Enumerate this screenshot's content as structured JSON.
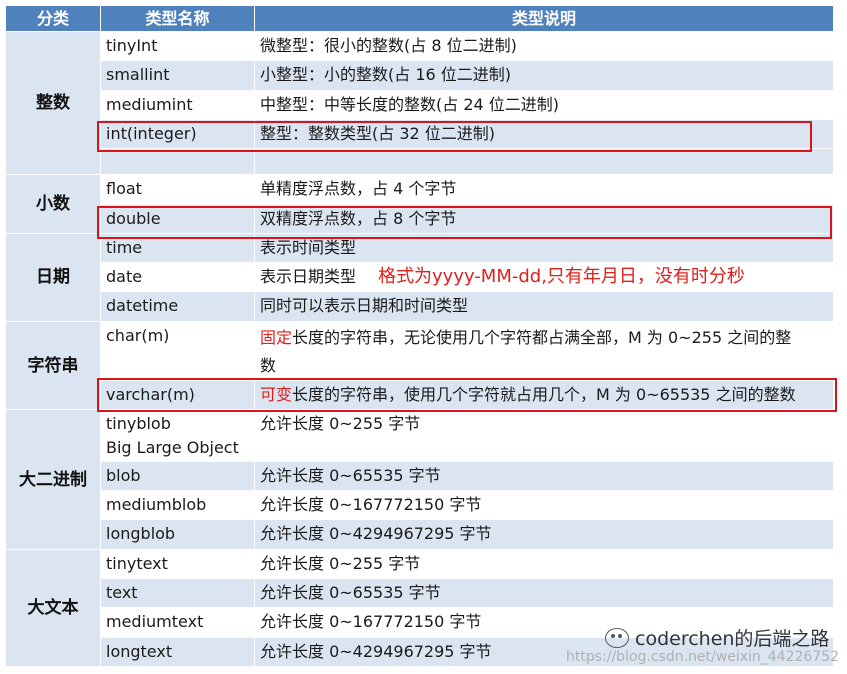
{
  "header": {
    "col_category": "分类",
    "col_type_name": "类型名称",
    "col_description": "类型说明"
  },
  "groups": [
    {
      "category": "整数",
      "rows": [
        {
          "type": "tinyInt",
          "desc": "微整型：很小的整数(占 8 位二进制)"
        },
        {
          "type": "smallint",
          "desc": "小整型：小的整数(占 16 位二进制)"
        },
        {
          "type": "mediumint",
          "desc": "中整型：中等长度的整数(占 24 位二进制)"
        },
        {
          "type": "int(integer)",
          "desc": "整型：整数类型(占 32 位二进制)"
        }
      ]
    },
    {
      "category": "小数",
      "rows": [
        {
          "type": "float",
          "desc": "单精度浮点数，占 4 个字节"
        },
        {
          "type": "double",
          "desc": "双精度浮点数，占 8 个字节"
        }
      ]
    },
    {
      "category": "日期",
      "rows": [
        {
          "type": "time",
          "desc": "表示时间类型"
        },
        {
          "type": "date",
          "desc": "表示日期类型",
          "note": "格式为yyyy-MM-dd,只有年月日，没有时分秒"
        },
        {
          "type": "datetime",
          "desc": "同时可以表示日期和时间类型"
        }
      ]
    },
    {
      "category": "字符串",
      "rows": [
        {
          "type": "char(m)",
          "desc_hl": "固定",
          "desc": "长度的字符串，无论使用几个字符都占满全部，M 为 0~255 之间的整",
          "desc_line2": "数"
        },
        {
          "type": "varchar(m)",
          "desc_hl": "可变",
          "desc": "长度的字符串，使用几个字符就占用几个，M 为 0~65535 之间的整数"
        }
      ]
    },
    {
      "category": "大二进制",
      "rows": [
        {
          "type": "tinyblob",
          "type_line2": "Big Large Object",
          "desc": "允许长度 0~255 字节"
        },
        {
          "type": "blob",
          "desc": "允许长度 0~65535 字节"
        },
        {
          "type": "mediumblob",
          "desc": "允许长度 0~167772150 字节"
        },
        {
          "type": "longblob",
          "desc": "允许长度 0~4294967295 字节"
        }
      ]
    },
    {
      "category": "大文本",
      "rows": [
        {
          "type": "tinytext",
          "desc": "允许长度 0~255 字节"
        },
        {
          "type": "text",
          "desc": "允许长度 0~65535 字节"
        },
        {
          "type": "mediumtext",
          "desc": "允许长度 0~167772150 字节"
        },
        {
          "type": "longtext",
          "desc": "允许长度 0~4294967295 字节"
        }
      ]
    }
  ],
  "watermark": {
    "brand": "coderchen的后端之路",
    "icon": "wechat-icon",
    "url": "https://blog.csdn.net/weixin_44226752"
  },
  "colors": {
    "header_bg": "#4f81bd",
    "shade_bg": "#dbe5f1",
    "highlight_red": "#d9141b"
  }
}
